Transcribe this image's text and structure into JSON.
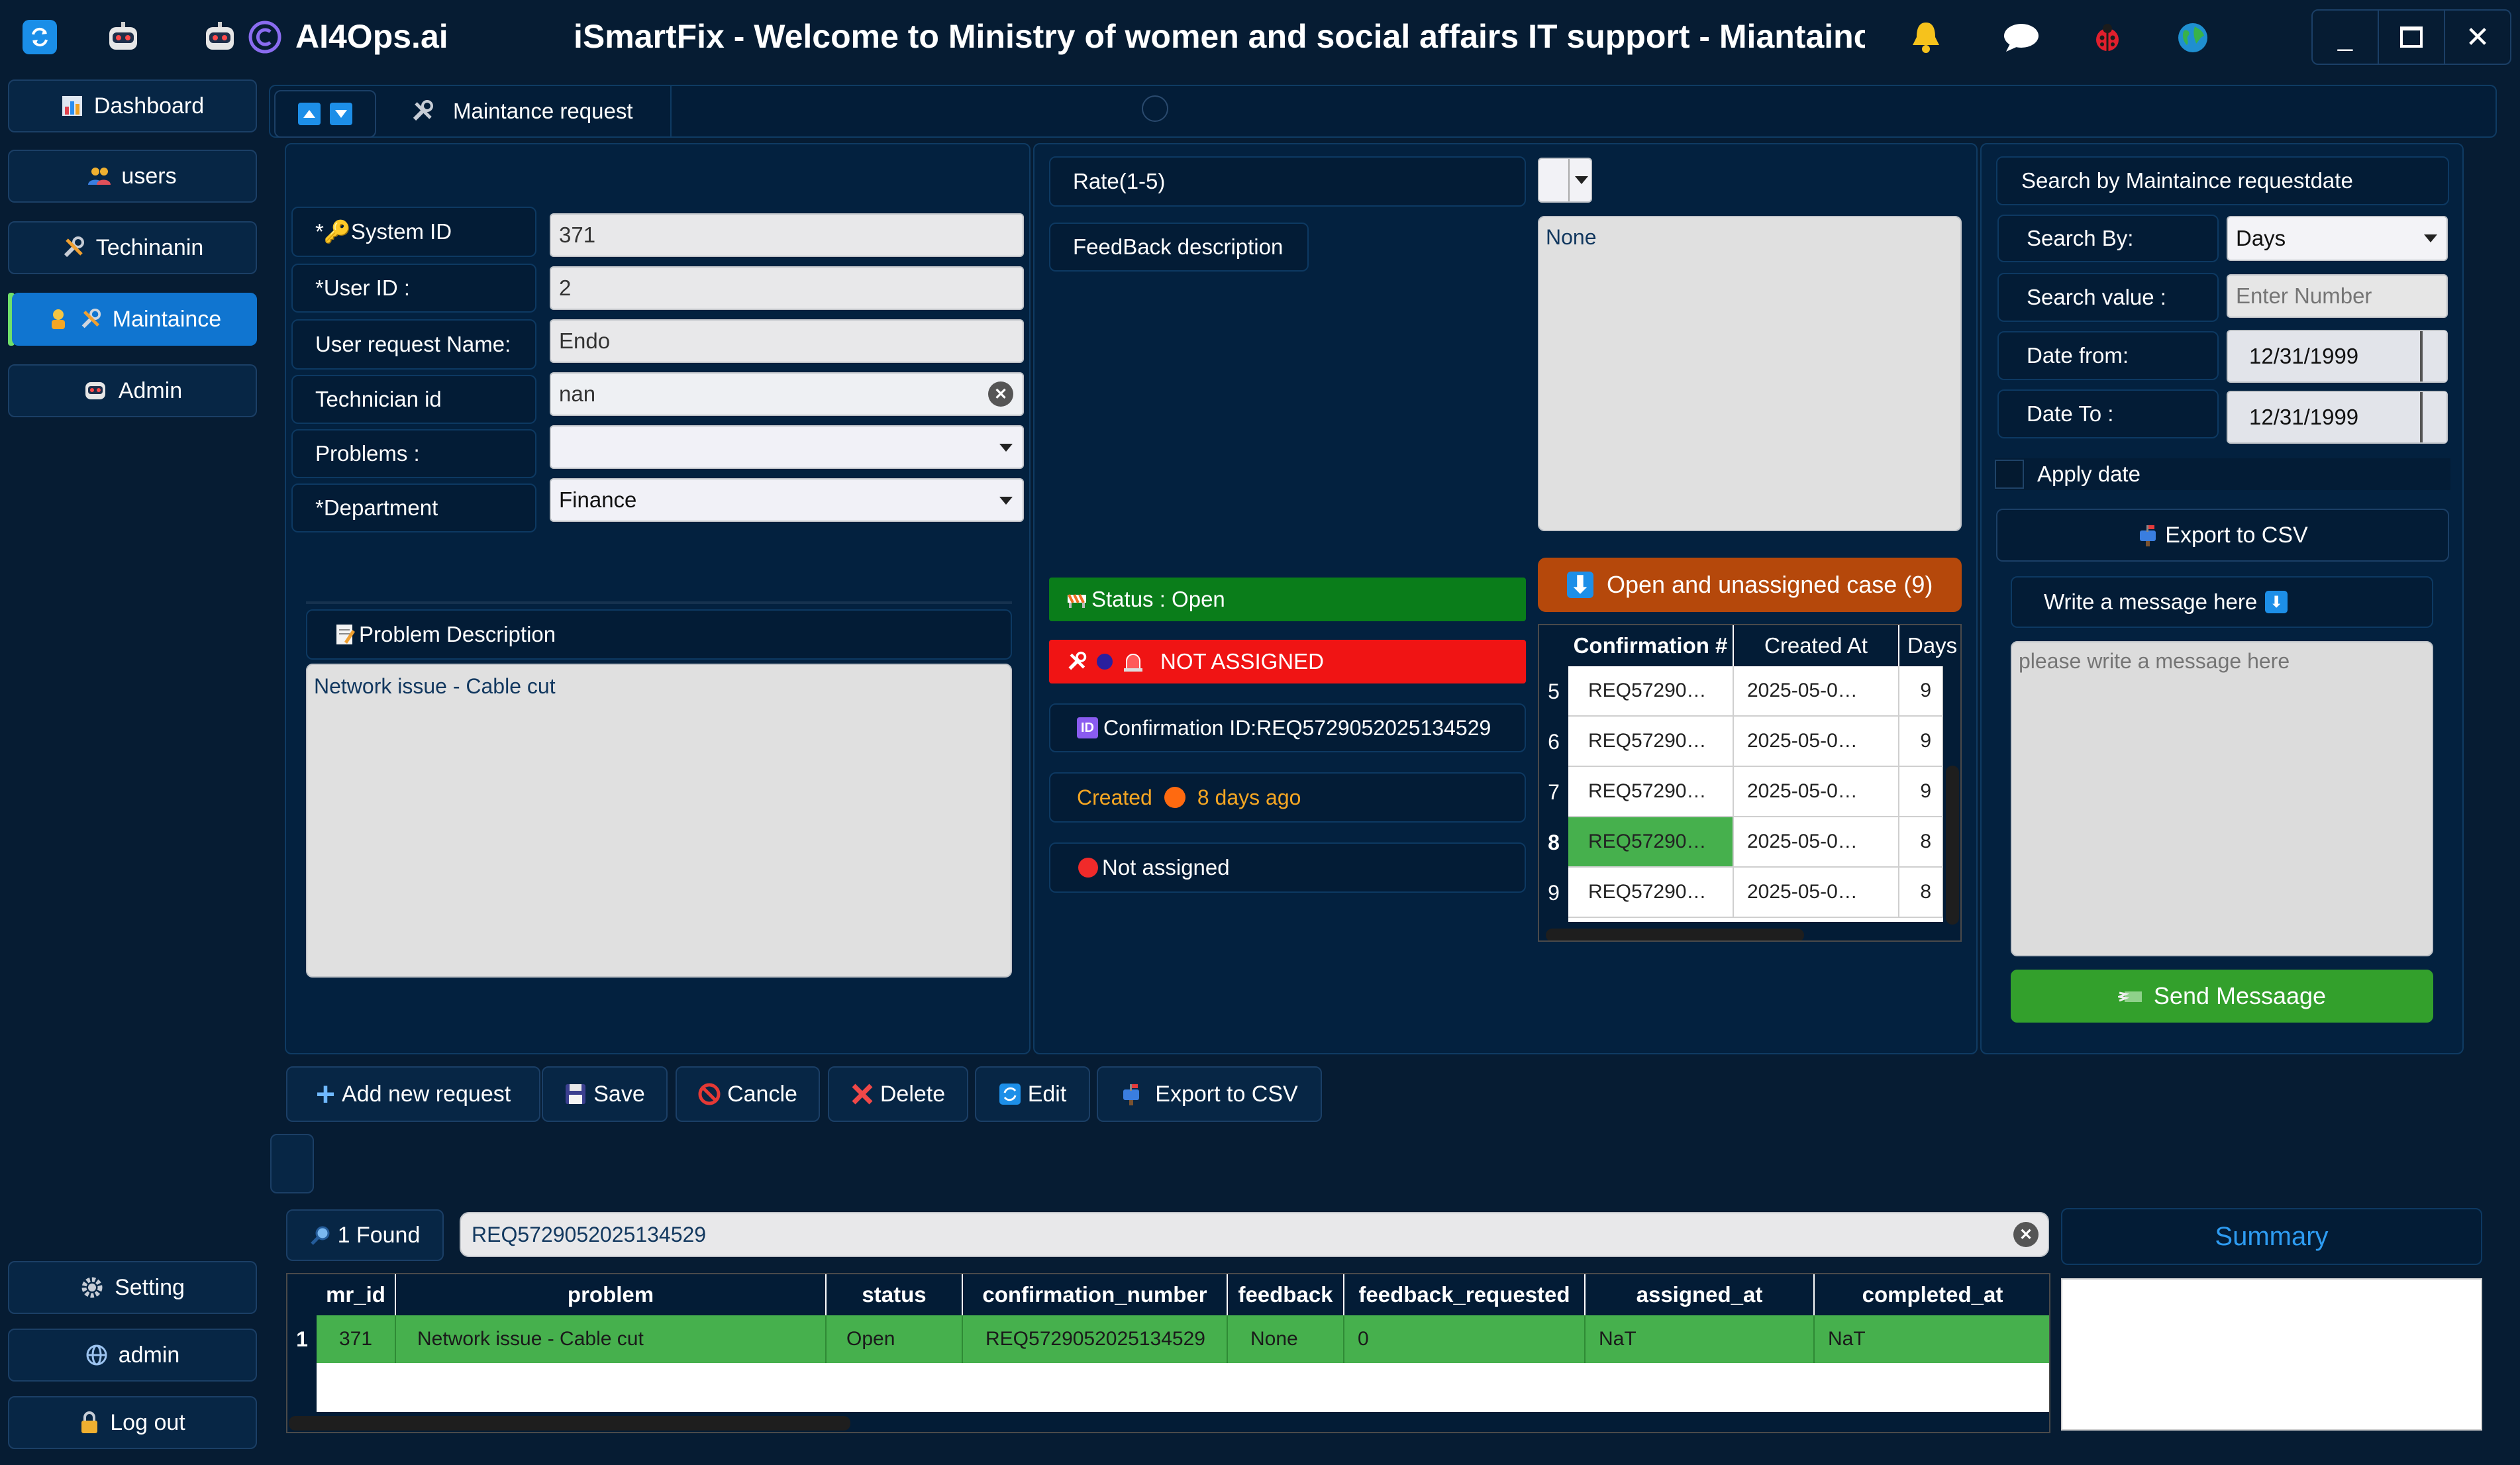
{
  "titlebar": {
    "brand": "AI4Ops.ai",
    "title": "iSmartFix - Welcome to Ministry of women and social affairs IT support  - Miantaince request"
  },
  "sidebar": {
    "items": [
      {
        "label": "Dashboard"
      },
      {
        "label": "users"
      },
      {
        "label": "Techinanin"
      },
      {
        "label": "Maintaince"
      },
      {
        "label": "Admin"
      }
    ],
    "bottom": [
      {
        "label": "Setting"
      },
      {
        "label": "admin"
      },
      {
        "label": "Log out"
      }
    ]
  },
  "tabs": {
    "active": "Maintance request"
  },
  "form": {
    "system_id": {
      "label": "*🔑System ID",
      "value": "371"
    },
    "user_id": {
      "label": "*User ID :",
      "value": "2"
    },
    "user_request_name": {
      "label": "User request Name:",
      "value": "Endo"
    },
    "technician_id": {
      "label": "Technician id",
      "value": "nan"
    },
    "problems": {
      "label": "Problems :",
      "value": ""
    },
    "department": {
      "label": "*Department",
      "value": "Finance"
    },
    "problem_description": {
      "label": "Problem Description",
      "value": "Network issue - Cable cut"
    }
  },
  "feedback": {
    "rate_label": "Rate(1-5)",
    "feedback_label": "FeedBack description",
    "feedback_value": "None"
  },
  "status": {
    "status_text": "Status : Open",
    "assigned_text": "NOT ASSIGNED",
    "confirmation_text": "Confirmation ID:REQ5729052025134529",
    "created_prefix": "Created",
    "created_ago": "8 days ago",
    "not_assigned": "Not assigned"
  },
  "open_cases": {
    "title": "Open and unassigned case (9)",
    "columns": [
      "Confirmation #",
      "Created At",
      "Days"
    ],
    "rows": [
      {
        "idx": "5",
        "conf": "REQ57290…",
        "created": "2025-05-0…",
        "days": "9"
      },
      {
        "idx": "6",
        "conf": "REQ57290…",
        "created": "2025-05-0…",
        "days": "9"
      },
      {
        "idx": "7",
        "conf": "REQ57290…",
        "created": "2025-05-0…",
        "days": "9"
      },
      {
        "idx": "8",
        "conf": "REQ57290…",
        "created": "2025-05-0…",
        "days": "8"
      },
      {
        "idx": "9",
        "conf": "REQ57290…",
        "created": "2025-05-0…",
        "days": "8"
      }
    ]
  },
  "search_panel": {
    "title": "Search by Maintaince requestdate",
    "search_by_label": "Search By:",
    "search_by_value": "Days",
    "search_value_label": "Search value :",
    "search_value_placeholder": "Enter Number",
    "date_from_label": "Date from:",
    "date_from_value": "12/31/1999",
    "date_to_label": "Date To :",
    "date_to_value": "12/31/1999",
    "apply_date": "Apply date",
    "export": "Export to CSV",
    "message_label": "Write a message here",
    "message_placeholder": "please write a message here",
    "send": "Send Messaage"
  },
  "actions": {
    "add": "Add new request",
    "save": "Save",
    "cancel": "Cancle",
    "delete": "Delete",
    "edit": "Edit",
    "export": "Export to CSV"
  },
  "results": {
    "found": "1 Found",
    "search_value": "REQ5729052025134529",
    "summary": "Summary",
    "columns": [
      "mr_id",
      "problem",
      "status",
      "confirmation_number",
      "feedback",
      "feedback_requested",
      "assigned_at",
      "completed_at"
    ],
    "rows": [
      {
        "idx": "1",
        "mr_id": "371",
        "problem": "Network issue - Cable cut",
        "status": "Open",
        "confirmation_number": "REQ5729052025134529",
        "feedback": "None",
        "feedback_requested": "0",
        "assigned_at": "NaT",
        "completed_at": "NaT"
      }
    ]
  },
  "colors": {
    "background": "#061c33",
    "panel": "#03213f",
    "active_nav": "#1075d0",
    "status_green": "#0a7d1a",
    "alert_red": "#f01414",
    "orange_header": "#b5480b",
    "row_green": "#46b04d",
    "send_green": "#33a02c"
  }
}
